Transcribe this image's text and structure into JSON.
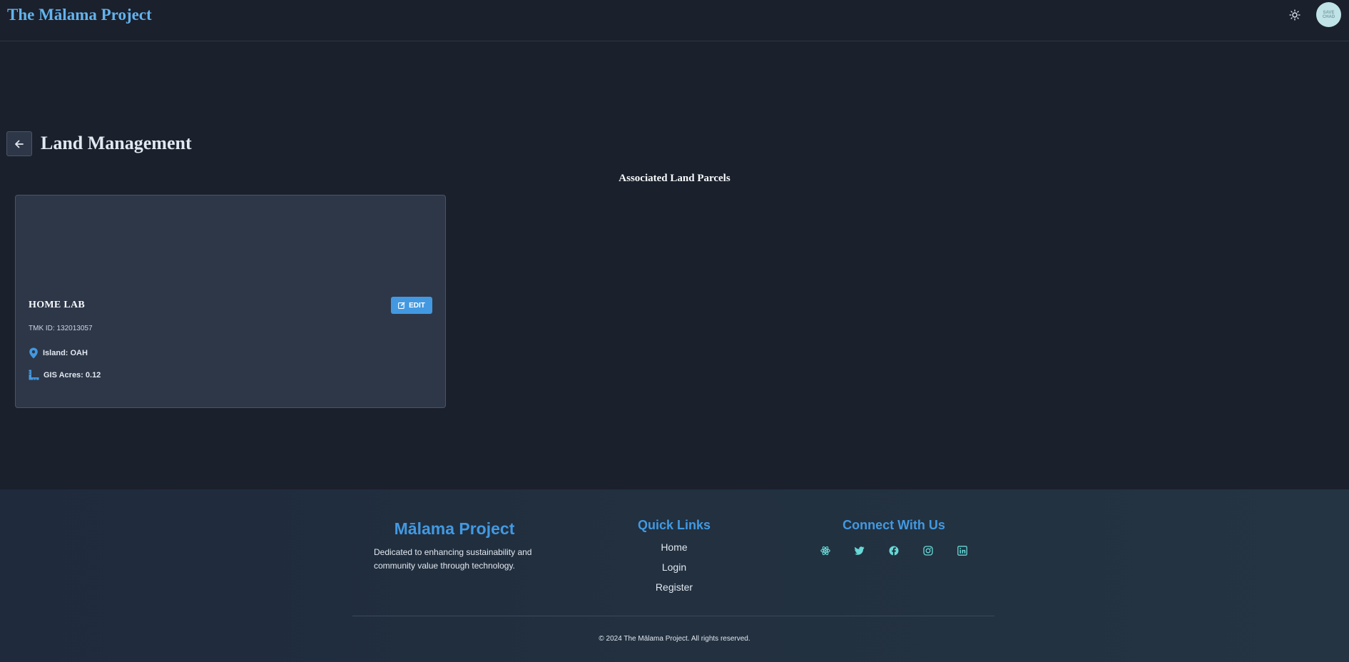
{
  "header": {
    "brand": "The Mālama Project",
    "avatar_text_line1": "SAVE",
    "avatar_text_line2": "CHAD"
  },
  "page": {
    "title": "Land Management",
    "section_title": "Associated Land Parcels"
  },
  "parcel": {
    "name": "HOME LAB",
    "edit_label": "EDIT",
    "tmk_label": "TMK ID:",
    "tmk_value": "132013057",
    "island": "Island: OAH",
    "acres": "GIS Acres: 0.12"
  },
  "footer": {
    "brand": "Mālama Project",
    "description": "Dedicated to enhancing sustainability and community value through technology.",
    "quick_links_title": "Quick Links",
    "links": [
      "Home",
      "Login",
      "Register"
    ],
    "connect_title": "Connect With Us",
    "socials": [
      "react-icon",
      "twitter-icon",
      "facebook-icon",
      "instagram-icon",
      "linkedin-icon"
    ],
    "copyright": "© 2024 The Mālama Project. All rights reserved."
  },
  "colors": {
    "background": "#1a202c",
    "accent": "#4299e1",
    "card": "#2d3748",
    "social_icons": "#68d8d6"
  }
}
